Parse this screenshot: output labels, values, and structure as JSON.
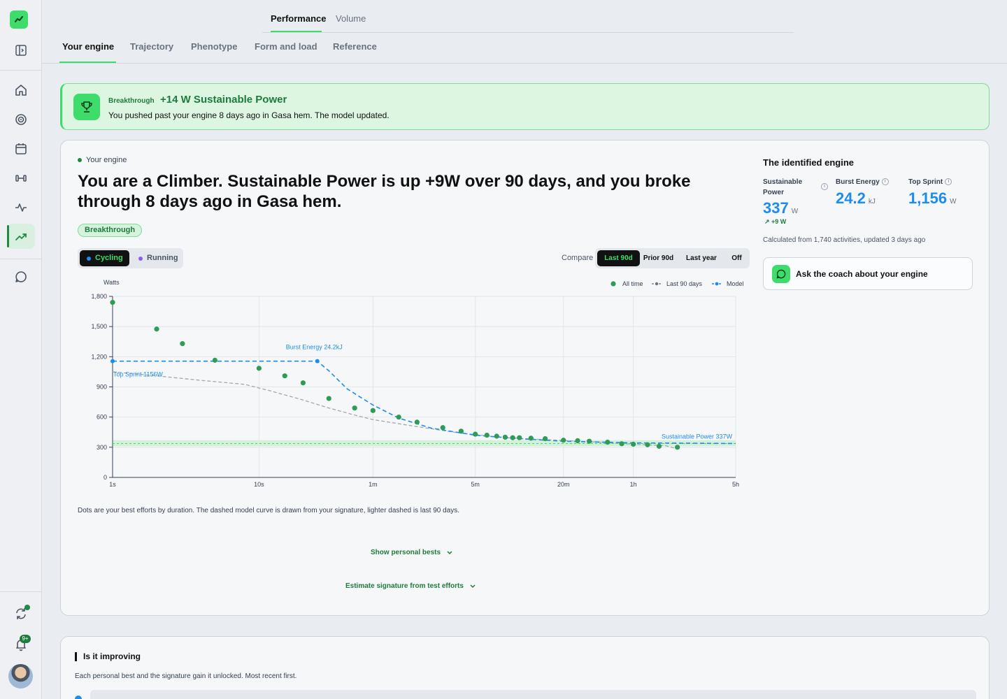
{
  "nav": {
    "top_tabs": [
      "Performance",
      "Volume"
    ],
    "sub_tabs": [
      "Your engine",
      "Trajectory",
      "Phenotype",
      "Form and load",
      "Reference"
    ],
    "notifications_badge": "9+"
  },
  "banner": {
    "tag": "Breakthrough",
    "title": "+14 W Sustainable Power",
    "text": "You pushed past your engine 8 days ago in Gasa hem. The model updated."
  },
  "engine": {
    "eyebrow": "Your engine",
    "headline": "You are a Climber. Sustainable Power is up +9W over 90 days, and you broke through 8 days ago in Gasa hem.",
    "pill": "Breakthrough",
    "sports": [
      "Cycling",
      "Running"
    ],
    "compare_label": "Compare",
    "compare_options": [
      "Last 90d",
      "Prior 90d",
      "Last year",
      "Off"
    ],
    "caption": "Dots are your best efforts by duration. The dashed model curve is drawn from your signature, lighter dashed is last 90 days.",
    "show_pbs": "Show personal bests",
    "estimate": "Estimate signature from test efforts"
  },
  "identified": {
    "title": "The identified engine",
    "sustainable_label": "Sustainable Power",
    "sustainable_value": "337",
    "sustainable_unit": "W",
    "sustainable_delta": "+9 W",
    "burst_label": "Burst Energy",
    "burst_value": "24.2",
    "burst_unit": "kJ",
    "sprint_label": "Top Sprint",
    "sprint_value": "1,156",
    "sprint_unit": "W",
    "calc": "Calculated from 1,740 activities, updated 3 days ago",
    "coach": "Ask the coach about your engine"
  },
  "improving": {
    "title": "Is it improving",
    "sub": "Each personal best and the signature gain it unlocked. Most recent first."
  },
  "chart_data": {
    "type": "scatter",
    "ylabel": "Watts",
    "xscale": "log",
    "x_ticks": [
      "1s",
      "10s",
      "1m",
      "5m",
      "20m",
      "1h",
      "5h"
    ],
    "x_tick_seconds": [
      1,
      10,
      60,
      300,
      1200,
      3600,
      18000
    ],
    "y_ticks": [
      "0",
      "300",
      "600",
      "900",
      "1,200",
      "1,500",
      "1,800"
    ],
    "ylim": [
      0,
      1800
    ],
    "legend": [
      "All time",
      "Last 90 days",
      "Model"
    ],
    "annotations": {
      "burst": "Burst Energy 24.2kJ",
      "sprint": "Top Sprint 1156W",
      "sustainable": "Sustainable Power 337W"
    },
    "colors": {
      "all_time": "#2e9b57",
      "last_90": "#a3a8af",
      "model": "#1d8cf0",
      "band": "#cdeecf"
    },
    "all_time": [
      {
        "x": 1,
        "y": 1740
      },
      {
        "x": 2,
        "y": 1475
      },
      {
        "x": 3,
        "y": 1330
      },
      {
        "x": 5,
        "y": 1165
      },
      {
        "x": 10,
        "y": 1085
      },
      {
        "x": 15,
        "y": 1010
      },
      {
        "x": 20,
        "y": 940
      },
      {
        "x": 30,
        "y": 785
      },
      {
        "x": 45,
        "y": 690
      },
      {
        "x": 60,
        "y": 665
      },
      {
        "x": 90,
        "y": 600
      },
      {
        "x": 120,
        "y": 550
      },
      {
        "x": 180,
        "y": 495
      },
      {
        "x": 240,
        "y": 460
      },
      {
        "x": 300,
        "y": 430
      },
      {
        "x": 360,
        "y": 420
      },
      {
        "x": 420,
        "y": 410
      },
      {
        "x": 480,
        "y": 400
      },
      {
        "x": 540,
        "y": 395
      },
      {
        "x": 600,
        "y": 395
      },
      {
        "x": 720,
        "y": 390
      },
      {
        "x": 900,
        "y": 385
      },
      {
        "x": 1200,
        "y": 370
      },
      {
        "x": 1500,
        "y": 365
      },
      {
        "x": 1800,
        "y": 360
      },
      {
        "x": 2400,
        "y": 350
      },
      {
        "x": 3000,
        "y": 335
      },
      {
        "x": 3600,
        "y": 330
      },
      {
        "x": 4500,
        "y": 325
      },
      {
        "x": 5400,
        "y": 310
      },
      {
        "x": 7200,
        "y": 300
      }
    ],
    "last_90": [
      {
        "x": 1,
        "y": 1050
      },
      {
        "x": 2,
        "y": 1010
      },
      {
        "x": 4,
        "y": 965
      },
      {
        "x": 8,
        "y": 925
      },
      {
        "x": 12,
        "y": 860
      },
      {
        "x": 20,
        "y": 770
      },
      {
        "x": 30,
        "y": 690
      },
      {
        "x": 45,
        "y": 620
      },
      {
        "x": 60,
        "y": 575
      },
      {
        "x": 120,
        "y": 505
      },
      {
        "x": 240,
        "y": 440
      },
      {
        "x": 480,
        "y": 395
      },
      {
        "x": 900,
        "y": 375
      },
      {
        "x": 1800,
        "y": 355
      },
      {
        "x": 3600,
        "y": 330
      },
      {
        "x": 6000,
        "y": 315
      },
      {
        "x": 7200,
        "y": 285
      }
    ],
    "model": [
      {
        "x": 1,
        "y": 1156
      },
      {
        "x": 25,
        "y": 1156
      },
      {
        "x": 30,
        "y": 1060
      },
      {
        "x": 40,
        "y": 880
      },
      {
        "x": 60,
        "y": 720
      },
      {
        "x": 90,
        "y": 590
      },
      {
        "x": 150,
        "y": 490
      },
      {
        "x": 300,
        "y": 420
      },
      {
        "x": 600,
        "y": 385
      },
      {
        "x": 1200,
        "y": 360
      },
      {
        "x": 3600,
        "y": 343
      },
      {
        "x": 18000,
        "y": 337
      }
    ]
  }
}
